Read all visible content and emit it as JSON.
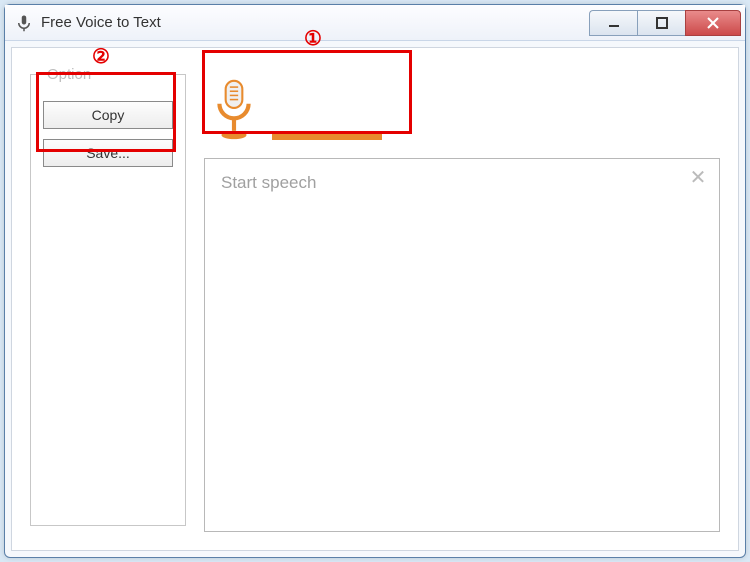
{
  "window": {
    "title": "Free Voice to Text"
  },
  "sidebar": {
    "group_label": "Option",
    "buttons": {
      "copy": "Copy",
      "save": "Save..."
    }
  },
  "main": {
    "placeholder": "Start speech"
  },
  "annotations": {
    "one": "①",
    "two": "②"
  }
}
